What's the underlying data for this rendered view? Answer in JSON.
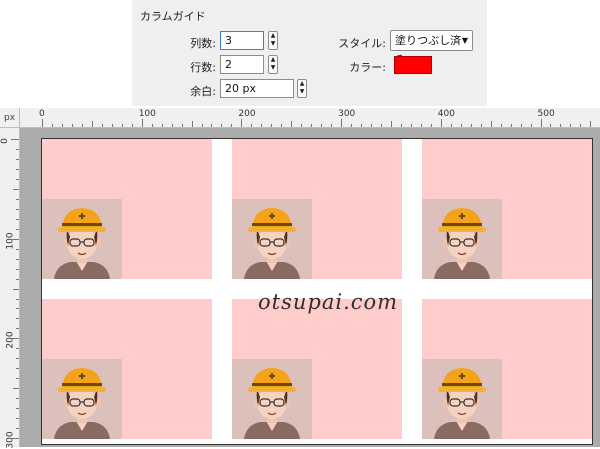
{
  "column_guide": {
    "title": "カラムガイド",
    "columns_label": "列数:",
    "columns_value": "3",
    "rows_label": "行数:",
    "rows_value": "2",
    "margin_label": "余白:",
    "margin_value": "20 px",
    "style_label": "スタイル:",
    "style_value": "塗りつぶし済み",
    "color_label": "カラー:",
    "color_value": "#ff0000"
  },
  "ruler": {
    "unit": "px",
    "h_labels": [
      "0",
      "100",
      "200",
      "300",
      "400",
      "500"
    ],
    "v_labels": [
      "0",
      "100",
      "200",
      "300"
    ]
  },
  "canvas": {
    "guide_fill": "#ffcccc",
    "watermark": "otsupai.com",
    "cells": [
      {
        "name": "guide-cell-r1c1"
      },
      {
        "name": "guide-cell-r1c2"
      },
      {
        "name": "guide-cell-r1c3"
      },
      {
        "name": "guide-cell-r2c1"
      },
      {
        "name": "guide-cell-r2c2"
      },
      {
        "name": "guide-cell-r2c3"
      }
    ]
  },
  "icons": {
    "spin": "up-down-stepper-icon",
    "dropdown": "chevron-down-icon",
    "avatar": "worker-hardhat-illustration"
  }
}
